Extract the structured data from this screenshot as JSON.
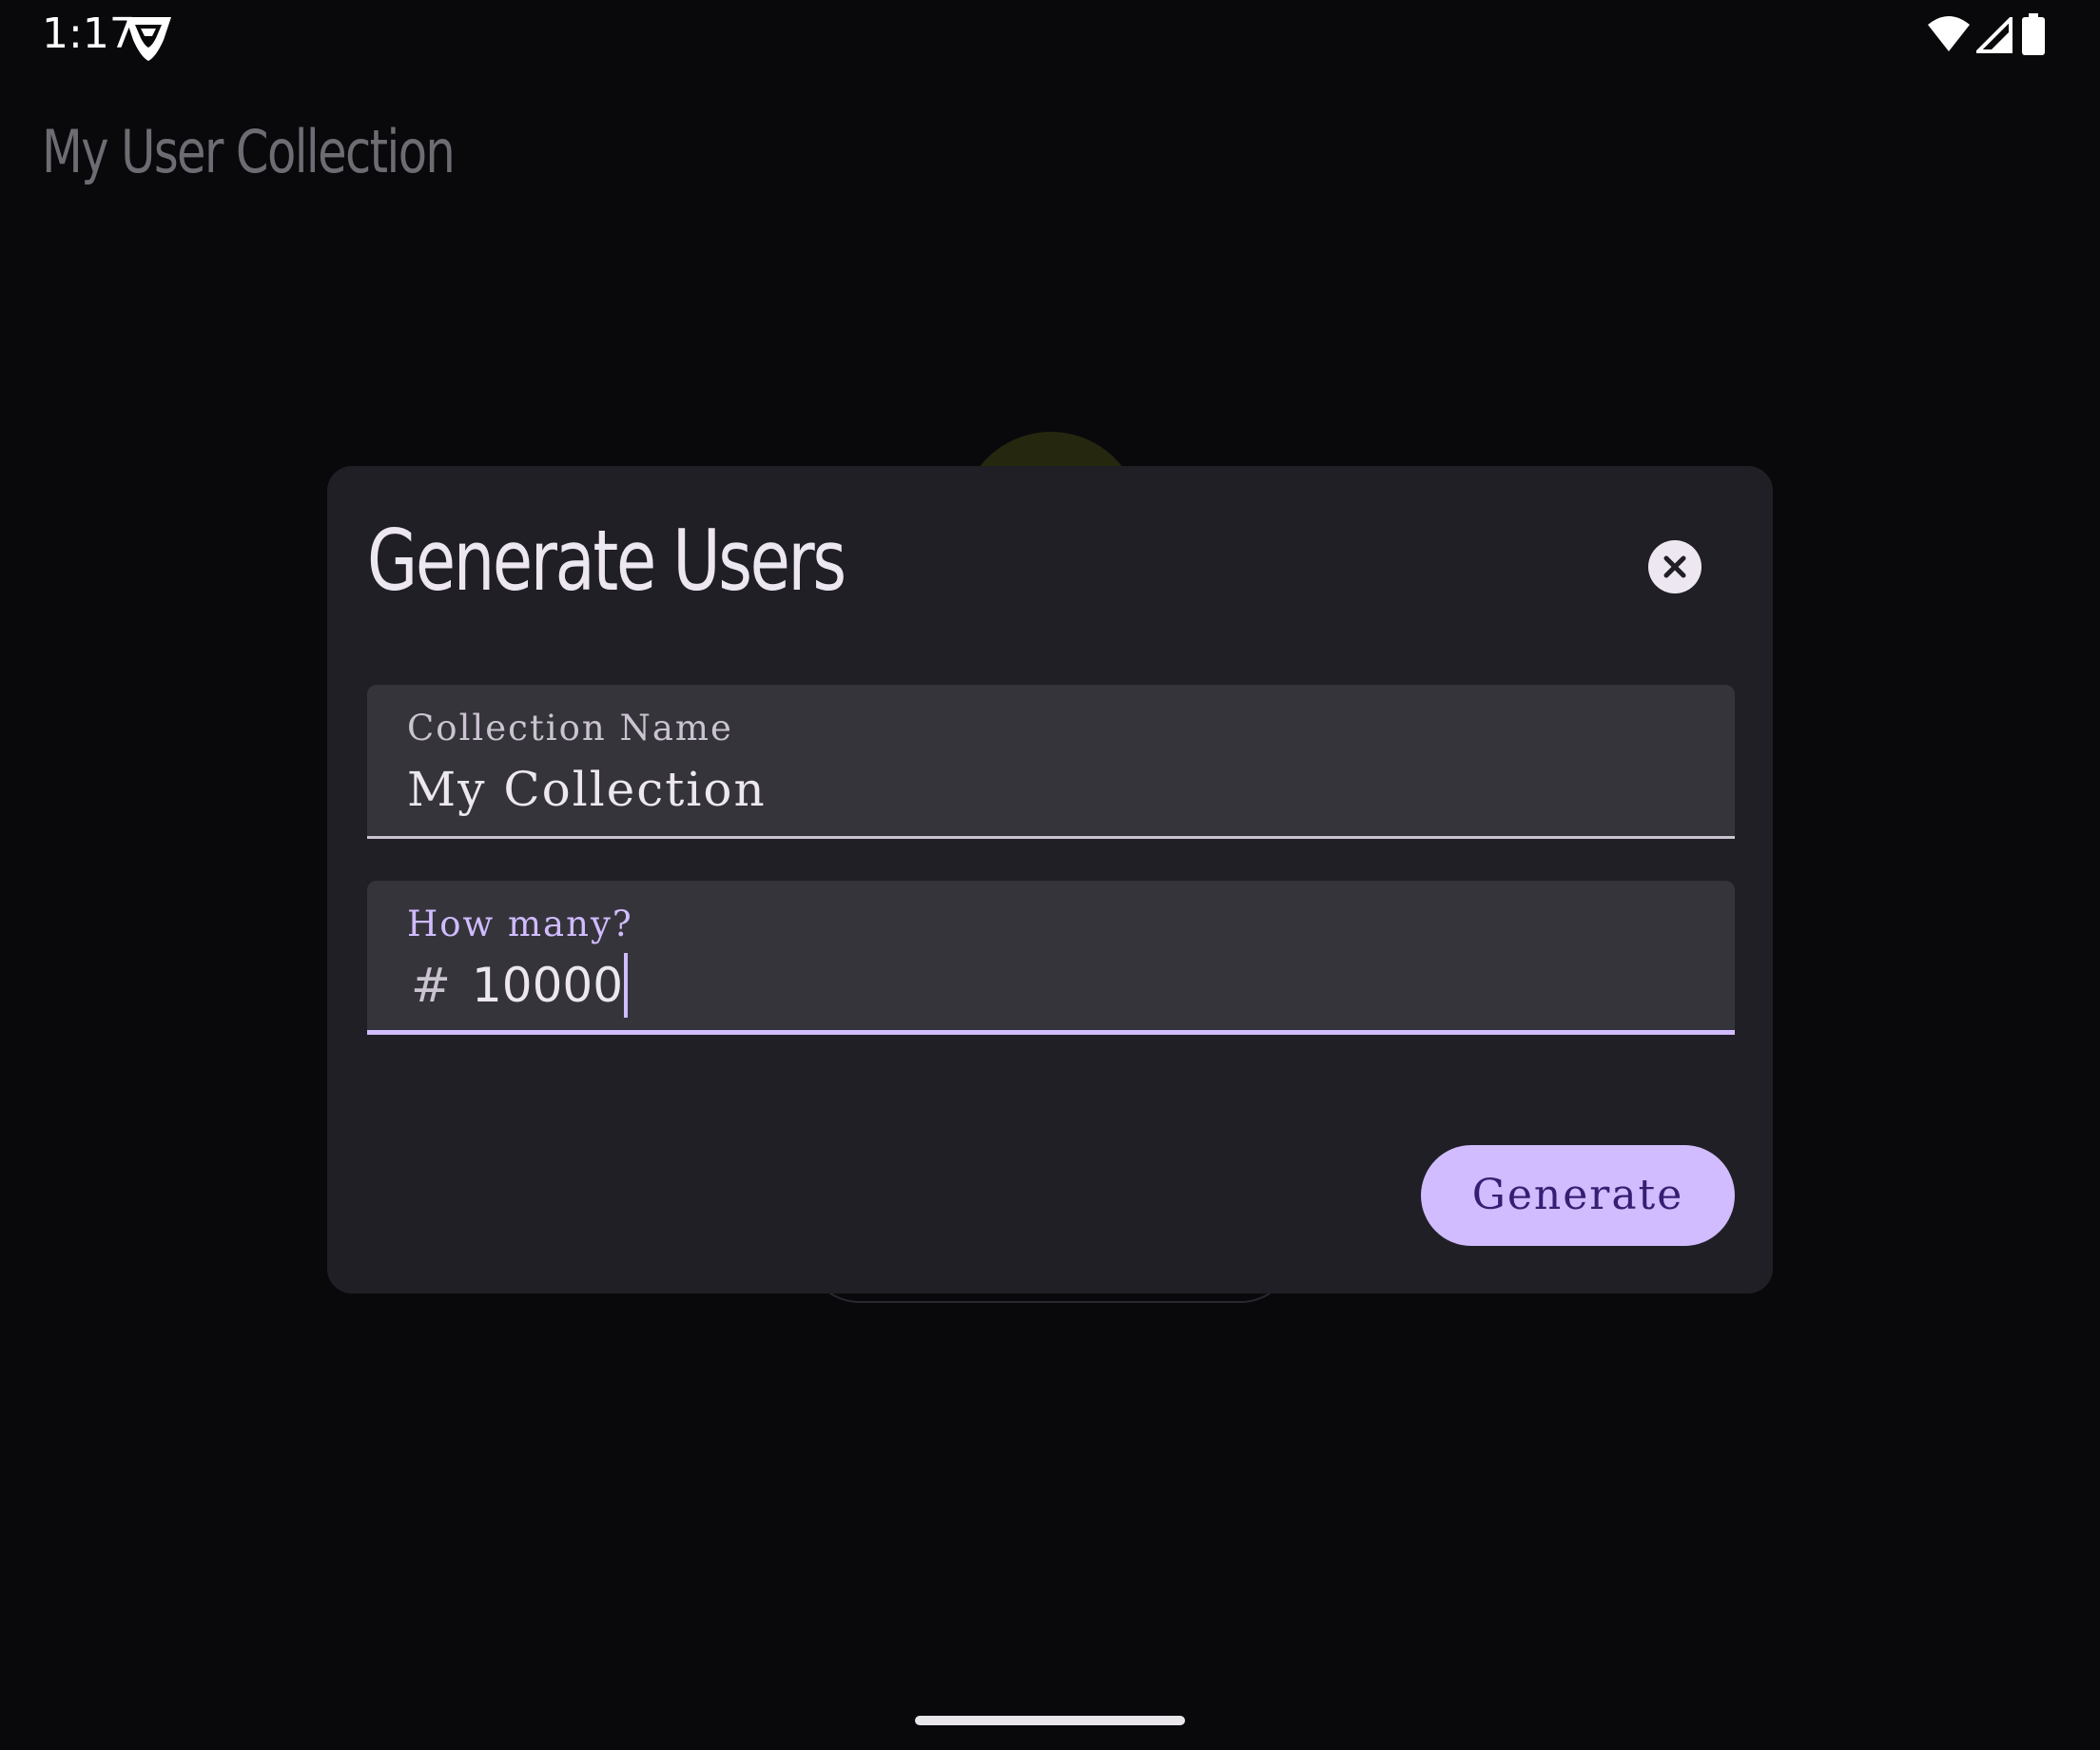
{
  "status_bar": {
    "time": "1:17",
    "app_icon": "shield-badge-icon",
    "wifi_icon": "wifi-icon",
    "signal_icon": "cell-signal-icon",
    "battery_icon": "battery-icon"
  },
  "app_bar": {
    "title": "My User Collection"
  },
  "dialog": {
    "title": "Generate Users",
    "close_icon": "close-icon",
    "collection_field": {
      "label": "Collection Name",
      "value": "My Collection"
    },
    "count_field": {
      "label": "How many?",
      "prefix_icon": "hash-icon",
      "prefix": "#",
      "value": "10000"
    },
    "generate_label": "Generate"
  },
  "colors": {
    "background": "#09090c",
    "dialog_surface": "#211f26",
    "field_surface": "#36343b",
    "primary": "#d0bcff",
    "on_primary": "#381e72"
  }
}
